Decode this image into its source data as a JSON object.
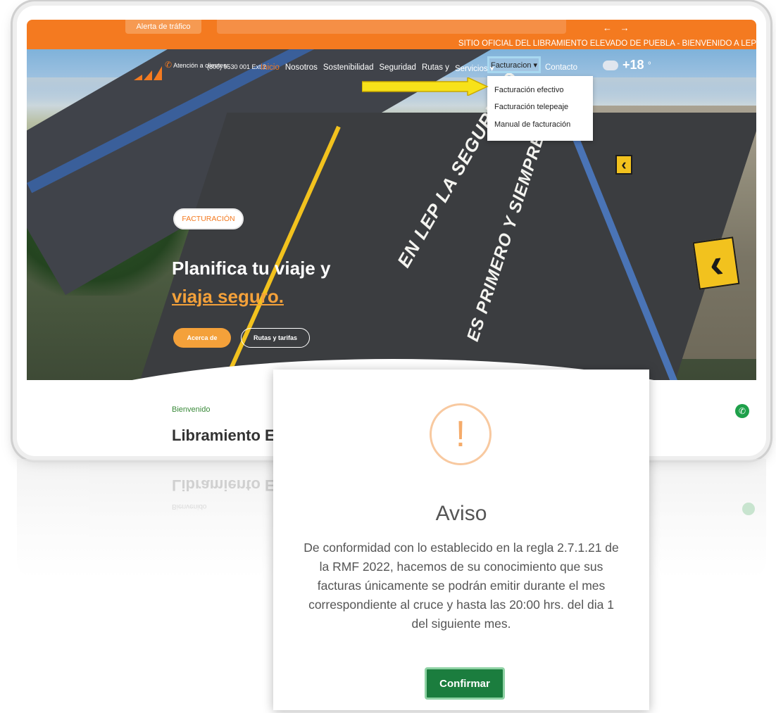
{
  "topbar": {
    "alert_label": "Alerta de tráfico",
    "arrows": "← →",
    "ticker": "SITIO OFICIAL DEL LIBRAMIENTO ELEVADO DE PUEBLA - BIENVENIDO A LEP"
  },
  "header": {
    "attention_label": "Atención a clientes:",
    "phone": "(800) 9530 001 Ext.2",
    "nav": [
      "Inicio",
      "Nosotros",
      "Sostenibilidad",
      "Seguridad",
      "Rutas y",
      "Servicios ▾"
    ],
    "facturacion": "Facturacion ▾",
    "contacto": "Contacto",
    "weather_temp": "+18",
    "weather_unit": "º"
  },
  "dropdown": {
    "items": [
      "Facturación efectivo",
      "Facturación telepeaje",
      "Manual de facturación"
    ]
  },
  "hero": {
    "tag": "FACTURACIÓN",
    "title_line1": "Planifica tu viaje y",
    "title_line2": "viaja seguro.",
    "btn_acerca": "Acerca de",
    "btn_rutas": "Rutas y tarifas",
    "road_text_1": "EN LEP LA SEGURIDAD",
    "road_text_2": "ES PRIMERO Y SIEMPRE"
  },
  "content": {
    "welcome": "Bienvenido",
    "title": "Libramiento E"
  },
  "modal": {
    "icon": "!",
    "title": "Aviso",
    "text": "De conformidad con lo establecido en la regla 2.7.1.21 de la RMF 2022, hacemos de su conocimiento que sus facturas únicamente se podrán emitir durante el mes correspondiente al cruce y hasta las 20:00 hrs. del dia 1 del siguiente mes.",
    "confirm": "Confirmar"
  },
  "colors": {
    "brand_orange": "#f47a20",
    "accent_yellow": "#f4a13a",
    "confirm_green": "#1b7d3e",
    "annotation_arrow": "#f7e21a"
  },
  "icons": [
    "phone-icon",
    "cloud-icon",
    "whatsapp-icon",
    "warning-icon",
    "arrow-annotation-icon",
    "chevron-sign-icon"
  ]
}
